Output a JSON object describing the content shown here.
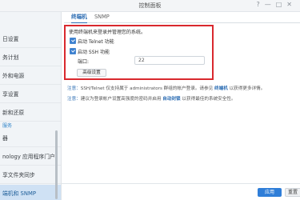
{
  "window": {
    "title": "控制面板",
    "controls": [
      "?",
      "—",
      "□",
      "✕"
    ]
  },
  "sidebar": {
    "items": [
      {
        "label": "日设置"
      },
      {
        "label": "务计划"
      },
      {
        "label": "外和电源"
      },
      {
        "label": "享设置"
      },
      {
        "label": "新和还原"
      }
    ],
    "section_label": "服务",
    "items2": [
      {
        "label": "器"
      },
      {
        "label": "nology 应用程序门户"
      },
      {
        "label": "享文件夹同步"
      },
      {
        "label": "端机和 SNMP",
        "active": true
      }
    ]
  },
  "tabs": [
    {
      "label": "终端机",
      "active": true
    },
    {
      "label": "SNMP",
      "active": false
    }
  ],
  "main": {
    "description": "使用终端机来登录并管理您的系统。",
    "telnet_label": "启动 Telnet 功能",
    "ssh_label": "启动 SSH 功能",
    "port_label": "端口:",
    "port_value": "22",
    "advanced_button": "高级设置",
    "note1_prefix": "注意：",
    "note1_text_a": "SSH/Telnet 仅支持属于 administrators 群组的帐户登录。请参见 ",
    "note1_link": "终端机",
    "note1_text_b": " 以获得更多详情。",
    "note2_prefix": "注意：",
    "note2_text_a": "建议为登录帐户设置高强度的密码并启用 ",
    "note2_link": "自动封锁",
    "note2_text_b": " 以获得最佳的系统安全性。"
  },
  "footer": {
    "apply_label": "应用",
    "reset_label": "重置"
  },
  "colors": {
    "accent": "#2f7ed8",
    "highlight_border": "#d9282e"
  }
}
